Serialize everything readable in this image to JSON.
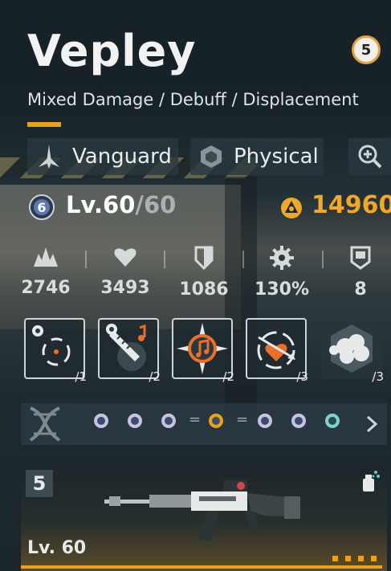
{
  "character": {
    "name": "Vepley",
    "roles": "Mixed Damage / Debuff / Displacement",
    "rank_badge": "5"
  },
  "tags": {
    "class_label": "Vanguard",
    "element_label": "Physical"
  },
  "level": {
    "current": "Lv.60",
    "separator": "/",
    "max": "60"
  },
  "currency": {
    "amount": "14960"
  },
  "stats": [
    {
      "icon": "attack-icon",
      "value": "2746"
    },
    {
      "icon": "hp-heart-icon",
      "value": "3493"
    },
    {
      "icon": "defense-shield-icon",
      "value": "1086"
    },
    {
      "icon": "crit-gear-icon",
      "value": "130%"
    },
    {
      "icon": "cost-badge-icon",
      "value": "8"
    }
  ],
  "skills": [
    {
      "icon": "target-skill-icon",
      "count": "/1"
    },
    {
      "icon": "blade-note-skill-icon",
      "count": "/2"
    },
    {
      "icon": "music-compass-skill-icon",
      "count": "/2"
    },
    {
      "icon": "heart-arrow-skill-icon",
      "count": "/3"
    },
    {
      "icon": "cloud-skill-icon",
      "count": "/3"
    }
  ],
  "neural_lane": {
    "eq1": "=",
    "eq2": "="
  },
  "weapon": {
    "rank": "5",
    "level": "Lv. 60"
  },
  "colors": {
    "accent": "#e8a21c",
    "coin": "#f0a82a"
  }
}
